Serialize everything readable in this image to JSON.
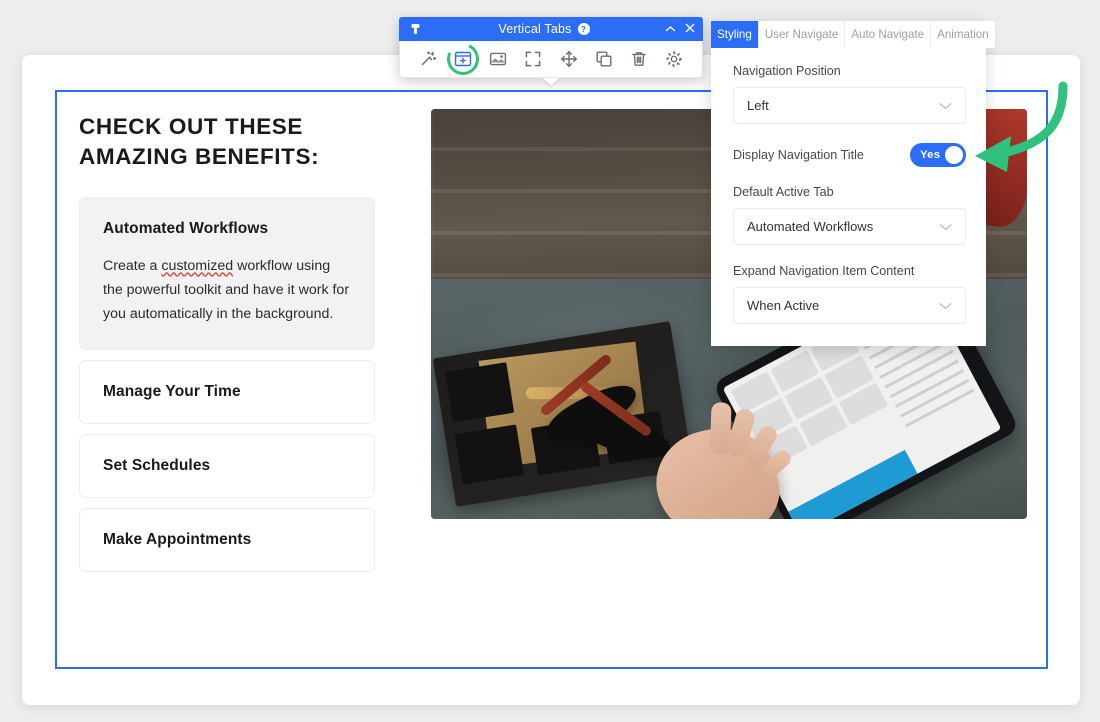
{
  "module_toolbar": {
    "title": "Vertical Tabs",
    "help_icon": "help-icon",
    "pin_icon": "pin-icon",
    "collapse_icon": "chevron-up-icon",
    "close_icon": "close-icon",
    "accent_color": "#2b6ef5",
    "highlight_color": "#2ec27e",
    "icons": [
      {
        "name": "magic-wand-icon",
        "label": "Style Module"
      },
      {
        "name": "module-add-icon",
        "label": "Add Module",
        "highlighted": true
      },
      {
        "name": "image-icon",
        "label": "Background Image"
      },
      {
        "name": "fullscreen-icon",
        "label": "Expand"
      },
      {
        "name": "move-icon",
        "label": "Move Module"
      },
      {
        "name": "duplicate-icon",
        "label": "Duplicate Module"
      },
      {
        "name": "trash-icon",
        "label": "Delete Module"
      },
      {
        "name": "gear-icon",
        "label": "Module Settings"
      }
    ]
  },
  "settings_panel": {
    "tabs": [
      {
        "label": "Styling",
        "active": true
      },
      {
        "label": "User Navigate",
        "active": false
      },
      {
        "label": "Auto Navigate",
        "active": false
      },
      {
        "label": "Animation",
        "active": false
      }
    ],
    "fields": [
      {
        "label": "Navigation Position",
        "type": "select",
        "value": "Left"
      },
      {
        "label": "Display Navigation Title",
        "type": "toggle",
        "value": "Yes",
        "on": true
      },
      {
        "label": "Default Active Tab",
        "type": "select",
        "value": "Automated Workflows"
      },
      {
        "label": "Expand Navigation Item Content",
        "type": "select",
        "value": "When Active"
      }
    ]
  },
  "content": {
    "headline_lines": [
      "CHECK OUT THESE",
      "AMAZING BENEFITS:"
    ],
    "tabs": [
      {
        "title": "Automated Workflows",
        "active": true,
        "body_before": "Create a ",
        "body_misspelled": "customized",
        "body_after": " workflow using the powerful toolkit and have it work for you automatically in the background."
      },
      {
        "title": "Manage Your Time",
        "active": false
      },
      {
        "title": "Set Schedules",
        "active": false
      },
      {
        "title": "Make Appointments",
        "active": false
      }
    ]
  },
  "annotation": {
    "arrow_color": "#2ec27e",
    "points_to": "Display Navigation Title toggle"
  }
}
